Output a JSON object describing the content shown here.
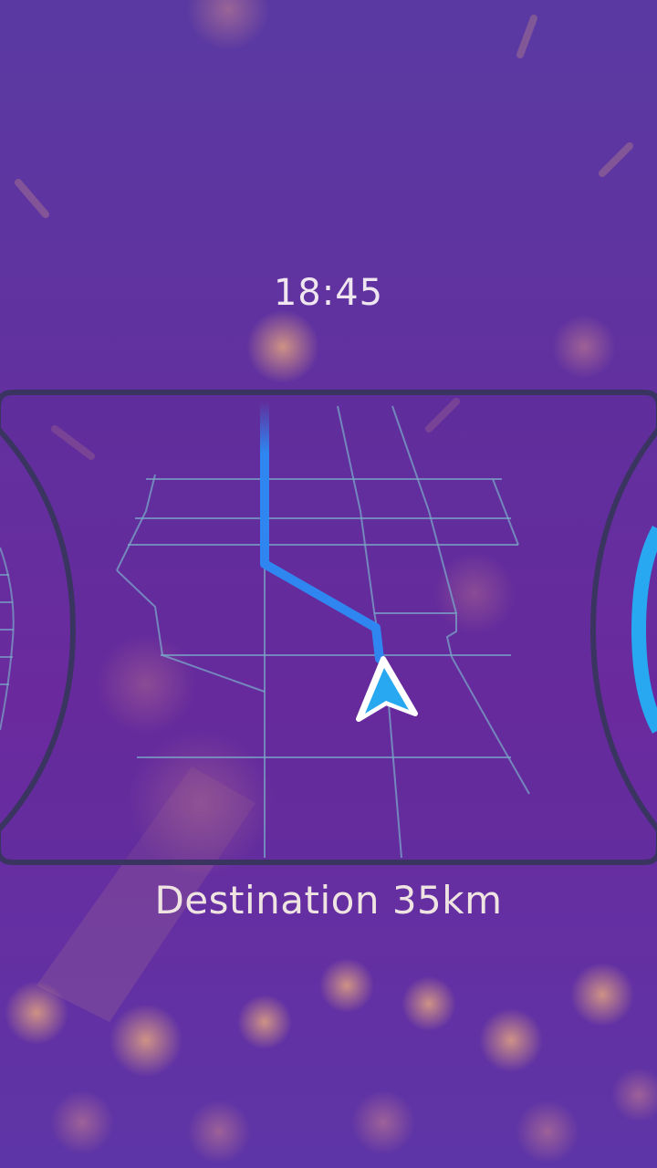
{
  "status": {
    "time": "18:45"
  },
  "navigation": {
    "destination_text": "Destination 35km"
  },
  "colors": {
    "background": "#62309f",
    "frame_stroke": "#3a3560",
    "route": "#2f86f0",
    "map_grid": "#7aa6c8",
    "gauge_right": "#27a8f0",
    "glow": "#f0b07a"
  },
  "icons": {
    "position_marker": "navigation-arrow-icon"
  }
}
